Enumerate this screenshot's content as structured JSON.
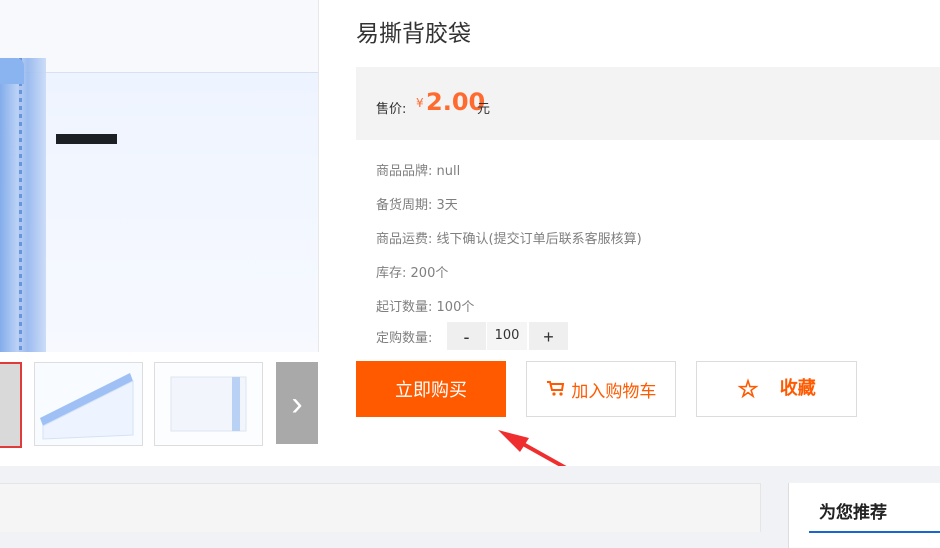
{
  "product": {
    "title": "易撕背胶袋"
  },
  "price": {
    "label": "售价:",
    "currency": "¥",
    "value": "2.00",
    "unit": "元"
  },
  "info": {
    "brand": {
      "label": "商品品牌:",
      "value": "null"
    },
    "stock_period": {
      "label": "备货周期:",
      "value": "3天"
    },
    "shipping": {
      "label": "商品运费:",
      "value": "线下确认(提交订单后联系客服核算)"
    },
    "inventory": {
      "label": "库存:",
      "value": "200个"
    },
    "min_order": {
      "label": "起订数量:",
      "value": "100个"
    }
  },
  "quantity": {
    "label": "定购数量:",
    "minus": "-",
    "plus": "+",
    "value": "100"
  },
  "buttons": {
    "buy": "立即购买",
    "cart": "加入购物车",
    "favorite": "收藏"
  },
  "recommend": {
    "title": "为您推荐"
  },
  "colors": {
    "accent": "#ff5a00",
    "price": "#ff6a2f",
    "annotation": "#ef2f2f",
    "recommend_underline": "#1a66d0"
  },
  "icons": {
    "cart": "cart-icon",
    "star": "star-icon",
    "next": "chevron-right-icon"
  }
}
